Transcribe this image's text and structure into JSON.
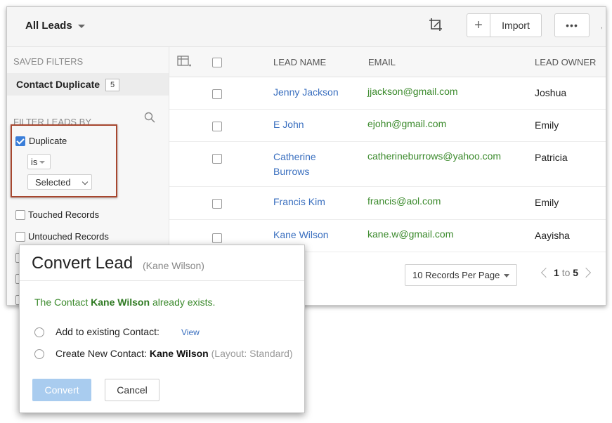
{
  "topbar": {
    "view_title": "All Leads",
    "import_label": "Import",
    "more_label": "•••",
    "plus_label": "+",
    "edge_label": ","
  },
  "sidebar": {
    "saved_filters_heading": "SAVED FILTERS",
    "saved_filter": {
      "label": "Contact Duplicate",
      "count": "5"
    },
    "filter_heading": "FILTER LEADS BY",
    "duplicate_filter": {
      "label": "Duplicate",
      "checked": true,
      "operator": "is",
      "value": "Selected"
    },
    "filters": [
      {
        "label": "Touched Records",
        "checked": false
      },
      {
        "label": "Untouched Records",
        "checked": false
      }
    ]
  },
  "grid": {
    "columns": [
      "LEAD NAME",
      "EMAIL",
      "LEAD OWNER"
    ],
    "rows": [
      {
        "name": "Jenny Jackson",
        "email": "jjackson@gmail.com",
        "owner": "Joshua"
      },
      {
        "name": "E John",
        "email": "ejohn@gmail.com",
        "owner": "Emily"
      },
      {
        "name": "Catherine Burrows",
        "email": "catherineburrows@yahoo.com",
        "owner": "Patricia"
      },
      {
        "name": "Francis Kim",
        "email": "francis@aol.com",
        "owner": "Emily"
      },
      {
        "name": "Kane Wilson",
        "email": "kane.w@gmail.com",
        "owner": "Aayisha"
      }
    ],
    "pager": {
      "per_page": "10 Records Per Page",
      "from": "1",
      "to_word": "to",
      "to": "5"
    }
  },
  "dialog": {
    "title": "Convert Lead",
    "subtitle": "(Kane Wilson)",
    "message_prefix": "The Contact",
    "message_name": "Kane Wilson",
    "message_suffix": "already exists.",
    "option_existing": "Add to existing Contact:",
    "view_link": "View",
    "option_new_prefix": "Create New Contact:",
    "option_new_name": "Kane Wilson",
    "option_new_layout": "(Layout: Standard)",
    "convert_label": "Convert",
    "cancel_label": "Cancel"
  },
  "colors": {
    "link": "#3a6fbf",
    "email": "#3b8a2c",
    "highlight_border": "#a7472f",
    "convert_btn": "#a9ccef",
    "checkbox": "#3a7ed9"
  }
}
